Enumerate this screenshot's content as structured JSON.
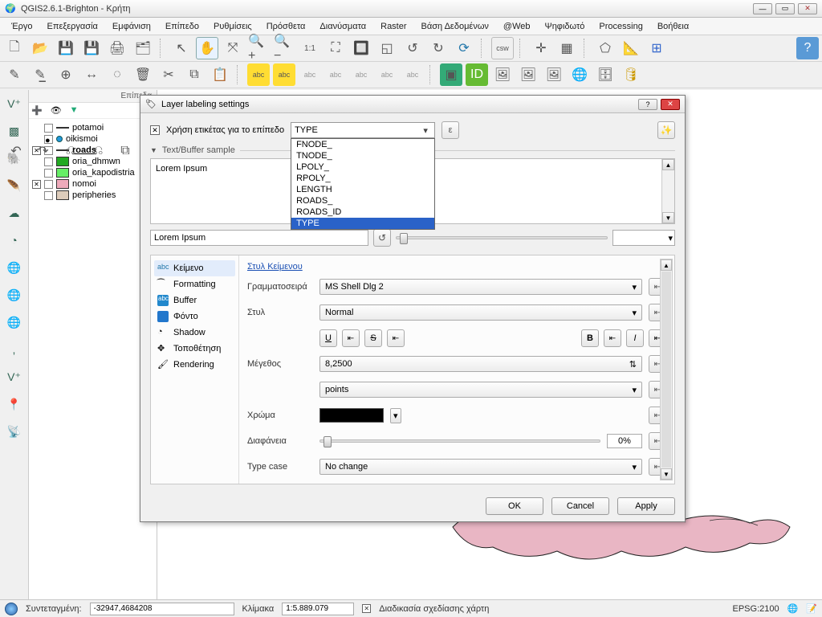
{
  "window": {
    "title": "QGIS2.6.1-Brighton - Κρήτη"
  },
  "menu": [
    "Έργο",
    "Επεξεργασία",
    "Εμφάνιση",
    "Επίπεδο",
    "Ρυθμίσεις",
    "Πρόσθετα",
    "Διανύσματα",
    "Raster",
    "Βάση Δεδομένων",
    "@Web",
    "Ψηφιδωτό",
    "Processing",
    "Βοήθεια"
  ],
  "layers_panel": {
    "title": "Επίπεδα",
    "items": [
      {
        "name": "potamoi",
        "checked": false,
        "kind": "line"
      },
      {
        "name": "oikismoi",
        "checked": true,
        "kind": "point"
      },
      {
        "name": "roads",
        "checked": false,
        "kind": "line",
        "current": true,
        "x": true
      },
      {
        "name": "oria_dhmwn",
        "checked": false,
        "kind": "poly",
        "color": "green"
      },
      {
        "name": "oria_kapodistria",
        "checked": false,
        "kind": "poly",
        "color": "lime"
      },
      {
        "name": "nomoi",
        "checked": false,
        "kind": "poly",
        "color": "pink",
        "x": true
      },
      {
        "name": "peripheries",
        "checked": false,
        "kind": "poly",
        "color": "tan"
      }
    ]
  },
  "dialog": {
    "title": "Layer labeling settings",
    "label_with_field": "Χρήση ετικέτας για το επίπεδο",
    "field_combo_value": "TYPE",
    "field_options": [
      "FNODE_",
      "TNODE_",
      "LPOLY_",
      "RPOLY_",
      "LENGTH",
      "ROADS_",
      "ROADS_ID",
      "TYPE"
    ],
    "field_selected": "TYPE",
    "epsilon": "ε",
    "sample_header": "Text/Buffer sample",
    "sample_text": "Lorem Ipsum",
    "lorem_input": "Lorem Ipsum",
    "tabs": [
      {
        "key": "text",
        "label": "Κείμενο",
        "icon": "abc"
      },
      {
        "key": "formatting",
        "label": "Formatting",
        "icon": "fmt"
      },
      {
        "key": "buffer",
        "label": "Buffer",
        "icon": "buf"
      },
      {
        "key": "background",
        "label": "Φόντο",
        "icon": "bg"
      },
      {
        "key": "shadow",
        "label": "Shadow",
        "icon": "shd"
      },
      {
        "key": "placement",
        "label": "Τοποθέτηση",
        "icon": "plc"
      },
      {
        "key": "rendering",
        "label": "Rendering",
        "icon": "rnd"
      }
    ],
    "text_style": {
      "heading": "Στυλ Κείμενου",
      "font_label": "Γραμματοσειρά",
      "font_value": "MS Shell Dlg 2",
      "style_label": "Στυλ",
      "style_value": "Normal",
      "u_btn": "U",
      "s_btn": "S",
      "b_btn": "B",
      "i_btn": "I",
      "size_label": "Μέγεθος",
      "size_value": "8,2500",
      "unit_value": "points",
      "color_label": "Χρώμα",
      "color_value": "#000000",
      "transparency_label": "Διαφάνεια",
      "transparency_value": "0%",
      "typecase_label": "Type case",
      "typecase_value": "No change"
    },
    "buttons": {
      "ok": "OK",
      "cancel": "Cancel",
      "apply": "Apply"
    }
  },
  "status": {
    "coord_label": "Συντεταγμένη:",
    "coord_value": "-32947,4684208",
    "scale_label": "Κλίμακα",
    "scale_value": "1:5.889.079",
    "render_label": "Διαδικασία σχεδίασης χάρτη",
    "epsg": "EPSG:2100"
  }
}
